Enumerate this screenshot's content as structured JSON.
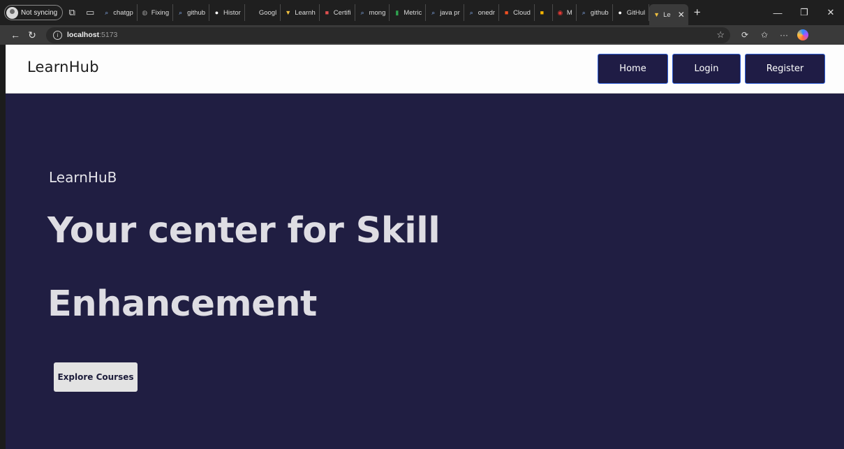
{
  "browser": {
    "profile_label": "Not syncing",
    "tabs": [
      {
        "label": "chatgp",
        "fav_color": "#8ab4f8",
        "fav_glyph": "⌕"
      },
      {
        "label": "Fixing",
        "fav_color": "#9a9a9a",
        "fav_glyph": "◍"
      },
      {
        "label": "github",
        "fav_color": "#8ab4f8",
        "fav_glyph": "⌕"
      },
      {
        "label": "Histor",
        "fav_color": "#ffffff",
        "fav_glyph": "●"
      },
      {
        "label": "Googl",
        "fav_color": "#1f1f1f",
        "fav_glyph": ""
      },
      {
        "label": "Learnh",
        "fav_color": "#f0c040",
        "fav_glyph": "▼"
      },
      {
        "label": "Certifi",
        "fav_color": "#e05050",
        "fav_glyph": "■"
      },
      {
        "label": "mong",
        "fav_color": "#8ab4f8",
        "fav_glyph": "⌕"
      },
      {
        "label": "Metric",
        "fav_color": "#2ea44f",
        "fav_glyph": "▮"
      },
      {
        "label": "java pr",
        "fav_color": "#8ab4f8",
        "fav_glyph": "⌕"
      },
      {
        "label": "onedr",
        "fav_color": "#8ab4f8",
        "fav_glyph": "⌕"
      },
      {
        "label": "Cloud",
        "fav_color": "#f25022",
        "fav_glyph": "■"
      },
      {
        "label": "",
        "fav_color": "#f4b400",
        "fav_glyph": "■"
      },
      {
        "label": "M",
        "fav_color": "#e53935",
        "fav_glyph": "◉"
      },
      {
        "label": "github",
        "fav_color": "#8ab4f8",
        "fav_glyph": "⌕"
      },
      {
        "label": "GitHul",
        "fav_color": "#ffffff",
        "fav_glyph": "●"
      }
    ],
    "active_tab": {
      "label": "Le",
      "fav_color": "#f0c040",
      "fav_glyph": "▼"
    },
    "url_host": "localhost",
    "url_port": ":5173"
  },
  "navbar": {
    "brand": "LearnHub",
    "links": {
      "home": "Home",
      "login": "Login",
      "register": "Register"
    }
  },
  "hero": {
    "eyebrow": "LearnHuB",
    "title_line1": "Your center for Skill",
    "title_line2": "Enhancement",
    "cta": "Explore Courses"
  },
  "colors": {
    "hero_bg": "#201e42",
    "nav_button_bg": "#1f1c45",
    "nav_button_border": "#2f5fd8",
    "cta_bg": "#e3e3e3"
  }
}
